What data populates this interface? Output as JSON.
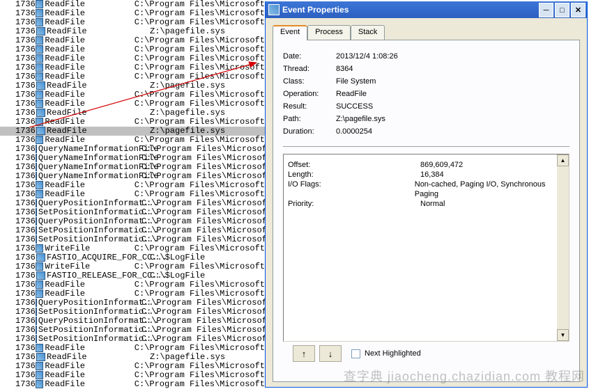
{
  "list": {
    "rows": [
      {
        "pid": "1736",
        "op": "ReadFile",
        "path": "C:\\Program Files\\Microsoft"
      },
      {
        "pid": "1736",
        "op": "ReadFile",
        "path": "C:\\Program Files\\Microsoft"
      },
      {
        "pid": "1736",
        "op": "ReadFile",
        "path": "C:\\Program Files\\Microsoft"
      },
      {
        "pid": "1736",
        "op": "ReadFile",
        "path": "Z:\\pagefile.sys"
      },
      {
        "pid": "1736",
        "op": "ReadFile",
        "path": "C:\\Program Files\\Microsoft"
      },
      {
        "pid": "1736",
        "op": "ReadFile",
        "path": "C:\\Program Files\\Microsoft"
      },
      {
        "pid": "1736",
        "op": "ReadFile",
        "path": "C:\\Program Files\\Microsoft"
      },
      {
        "pid": "1736",
        "op": "ReadFile",
        "path": "C:\\Program Files\\Microsoft"
      },
      {
        "pid": "1736",
        "op": "ReadFile",
        "path": "C:\\Program Files\\Microsoft"
      },
      {
        "pid": "1736",
        "op": "ReadFile",
        "path": "Z:\\pagefile.sys"
      },
      {
        "pid": "1736",
        "op": "ReadFile",
        "path": "C:\\Program Files\\Microsoft"
      },
      {
        "pid": "1736",
        "op": "ReadFile",
        "path": "C:\\Program Files\\Microsoft"
      },
      {
        "pid": "1736",
        "op": "ReadFile",
        "path": "Z:\\pagefile.sys"
      },
      {
        "pid": "1736",
        "op": "ReadFile",
        "path": "C:\\Program Files\\Microsoft"
      },
      {
        "pid": "1736",
        "op": "ReadFile",
        "path": "Z:\\pagefile.sys",
        "selected": true
      },
      {
        "pid": "1736",
        "op": "ReadFile",
        "path": "C:\\Program Files\\Microsoft"
      },
      {
        "pid": "1736",
        "op": "QueryNameInformationFile",
        "path": "C:\\Program Files\\Microsoft"
      },
      {
        "pid": "1736",
        "op": "QueryNameInformationFile",
        "path": "C:\\Program Files\\Microsoft"
      },
      {
        "pid": "1736",
        "op": "QueryNameInformationFile",
        "path": "C:\\Program Files\\Microsoft"
      },
      {
        "pid": "1736",
        "op": "QueryNameInformationFile",
        "path": "C:\\Program Files\\Microsoft"
      },
      {
        "pid": "1736",
        "op": "ReadFile",
        "path": "C:\\Program Files\\Microsoft"
      },
      {
        "pid": "1736",
        "op": "ReadFile",
        "path": "C:\\Program Files\\Microsoft"
      },
      {
        "pid": "1736",
        "op": "QueryPositionInformat...",
        "path": "C:\\Program Files\\Microsoft"
      },
      {
        "pid": "1736",
        "op": "SetPositionInformatio...",
        "path": "C:\\Program Files\\Microsoft"
      },
      {
        "pid": "1736",
        "op": "QueryPositionInformat...",
        "path": "C:\\Program Files\\Microsoft"
      },
      {
        "pid": "1736",
        "op": "SetPositionInformatio...",
        "path": "C:\\Program Files\\Microsoft"
      },
      {
        "pid": "1736",
        "op": "SetPositionInformatio...",
        "path": "C:\\Program Files\\Microsoft"
      },
      {
        "pid": "1736",
        "op": "WriteFile",
        "path": "C:\\Program Files\\Microsoft"
      },
      {
        "pid": "1736",
        "op": "FASTIO_ACQUIRE_FOR_CC...",
        "path": "C:\\$LogFile"
      },
      {
        "pid": "1736",
        "op": "WriteFile",
        "path": "C:\\Program Files\\Microsoft"
      },
      {
        "pid": "1736",
        "op": "FASTIO_RELEASE_FOR_CC...",
        "path": "C:\\$LogFile"
      },
      {
        "pid": "1736",
        "op": "ReadFile",
        "path": "C:\\Program Files\\Microsoft"
      },
      {
        "pid": "1736",
        "op": "ReadFile",
        "path": "C:\\Program Files\\Microsoft"
      },
      {
        "pid": "1736",
        "op": "QueryPositionInformat...",
        "path": "C:\\Program Files\\Microsoft"
      },
      {
        "pid": "1736",
        "op": "SetPositionInformatio...",
        "path": "C:\\Program Files\\Microsoft"
      },
      {
        "pid": "1736",
        "op": "QueryPositionInformat...",
        "path": "C:\\Program Files\\Microsoft"
      },
      {
        "pid": "1736",
        "op": "SetPositionInformatio...",
        "path": "C:\\Program Files\\Microsoft"
      },
      {
        "pid": "1736",
        "op": "SetPositionInformatio...",
        "path": "C:\\Program Files\\Microsoft"
      },
      {
        "pid": "1736",
        "op": "ReadFile",
        "path": "C:\\Program Files\\Microsoft"
      },
      {
        "pid": "1736",
        "op": "ReadFile",
        "path": "Z:\\pagefile.sys"
      },
      {
        "pid": "1736",
        "op": "ReadFile",
        "path": "C:\\Program Files\\Microsoft"
      },
      {
        "pid": "1736",
        "op": "ReadFile",
        "path": "C:\\Program Files\\Microsoft"
      },
      {
        "pid": "1736",
        "op": "ReadFile",
        "path": "C:\\Program Files\\Microsoft"
      }
    ]
  },
  "props": {
    "title": "Event Properties",
    "tabs": {
      "event": "Event",
      "process": "Process",
      "stack": "Stack"
    },
    "fields": {
      "date_label": "Date:",
      "date": "2013/12/4 1:08:26",
      "thread_label": "Thread:",
      "thread": "8364",
      "class_label": "Class:",
      "class": "File System",
      "operation_label": "Operation:",
      "operation": "ReadFile",
      "result_label": "Result:",
      "result": "SUCCESS",
      "path_label": "Path:",
      "path": "Z:\\pagefile.sys",
      "duration_label": "Duration:",
      "duration": "0.0000254"
    },
    "details": {
      "offset_label": "Offset:",
      "offset": "869,609,472",
      "length_label": "Length:",
      "length": "16,384",
      "ioflags_label": "I/O Flags:",
      "ioflags": "Non-cached, Paging I/O, Synchronous Paging",
      "priority_label": "Priority:",
      "priority": "Normal"
    },
    "nav": {
      "prev": "↑",
      "next": "↓",
      "next_highlighted": "Next Highlighted"
    },
    "winbtn": {
      "min": "0",
      "max": "1",
      "close": "r"
    }
  },
  "watermark": "查字典 jiaocheng.chazidian.com 教程网"
}
